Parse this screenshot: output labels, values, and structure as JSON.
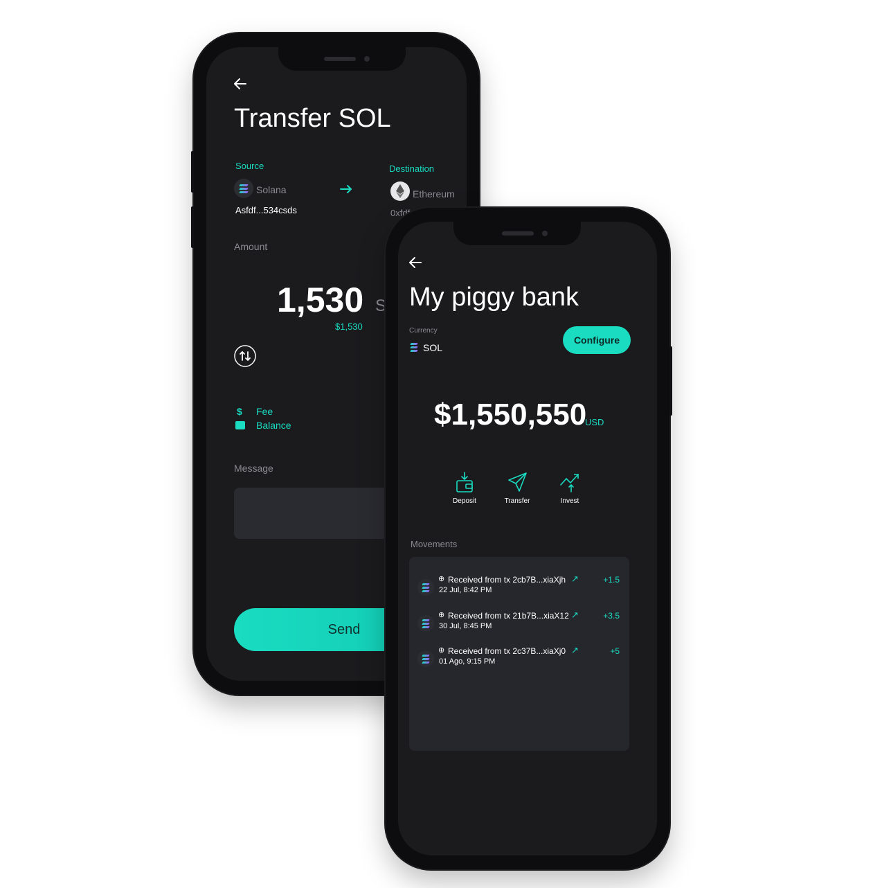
{
  "transfer": {
    "title": "Transfer SOL",
    "source_label": "Source",
    "source_name": "Solana",
    "source_address": "Asfdf...534csds",
    "destination_label": "Destination",
    "destination_name": "Ethereum",
    "destination_address": "0xfdf...534csds",
    "amount_label": "Amount",
    "amount_value": "1,530",
    "amount_unit": "SOL",
    "amount_usd": "$1,530",
    "fee_label": "Fee",
    "balance_label": "Balance",
    "message_label": "Message",
    "send_label": "Send"
  },
  "piggy": {
    "title": "My piggy bank",
    "currency_label": "Currency",
    "currency_value": "SOL",
    "configure_label": "Configure",
    "balance_value": "$1,550,550",
    "balance_unit": "USD",
    "actions": [
      {
        "label": "Deposit",
        "icon": "wallet-deposit-icon"
      },
      {
        "label": "Transfer",
        "icon": "paper-plane-icon"
      },
      {
        "label": "Invest",
        "icon": "trend-up-icon"
      }
    ],
    "movements_label": "Movements",
    "movements": [
      {
        "text": "Received from tx 2cb7B...xiaXjh",
        "date": "22 Jul, 8:42 PM",
        "amount": "+1.5"
      },
      {
        "text": "Received from tx 21b7B...xiaX12",
        "date": "30 Jul, 8:45 PM",
        "amount": "+3.5"
      },
      {
        "text": "Received from tx 2c37B...xiaXj0",
        "date": "01 Ago, 9:15 PM",
        "amount": "+5"
      }
    ]
  },
  "colors": {
    "accent": "#19dcc1",
    "background": "#1b1b1e",
    "card": "#26262d",
    "text": "#ffffff",
    "muted": "#8b8b92"
  }
}
